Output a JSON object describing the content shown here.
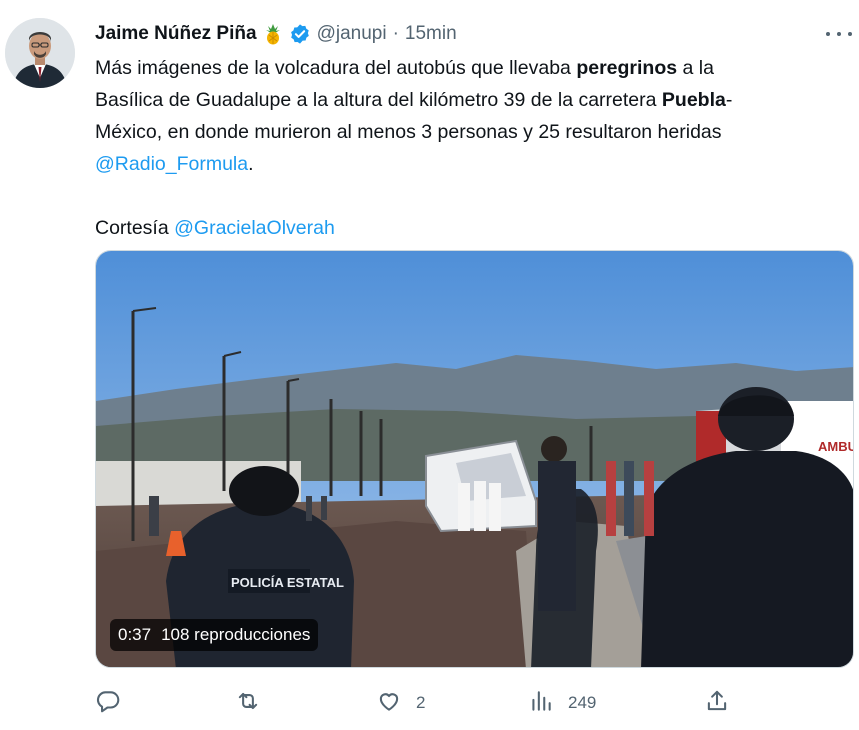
{
  "author": {
    "name": "Jaime Núñez Piña",
    "emoji": "pineapple-emoji",
    "verified": true,
    "handle": "@janupi",
    "separator": "·",
    "time": "15min"
  },
  "tweet": {
    "line1_pre": "Más imágenes de la volcadura del autobús que llevaba ",
    "line1_bold": "peregrinos",
    "line1_post": " a la",
    "line2_pre": "Basílica de Guadalupe a la altura del kilómetro 39 de la carretera ",
    "line2_bold": "Puebla",
    "line2_post": "-",
    "line3": "México, en donde murieron al menos 3 personas y 25 resultaron heridas",
    "mention1": "@Radio_Formula",
    "mention1_suffix": ".",
    "credit_label": "Cortesía ",
    "mention2": "@GracielaOlverah"
  },
  "media": {
    "duration": "0:37",
    "views": "108 reproducciones",
    "vest_text": "POLICÍA ESTATAL",
    "ambulance_text": "AMBU"
  },
  "actions": {
    "reply_count": "",
    "retweet_count": "",
    "like_count": "2",
    "views_count": "249"
  },
  "colors": {
    "link": "#1d9bf0",
    "secondary": "#536471",
    "verified": "#1d9bf0"
  },
  "icons": [
    "reply-icon",
    "retweet-icon",
    "like-icon",
    "views-icon",
    "share-icon",
    "more-icon",
    "verified-icon",
    "pineapple-emoji"
  ]
}
